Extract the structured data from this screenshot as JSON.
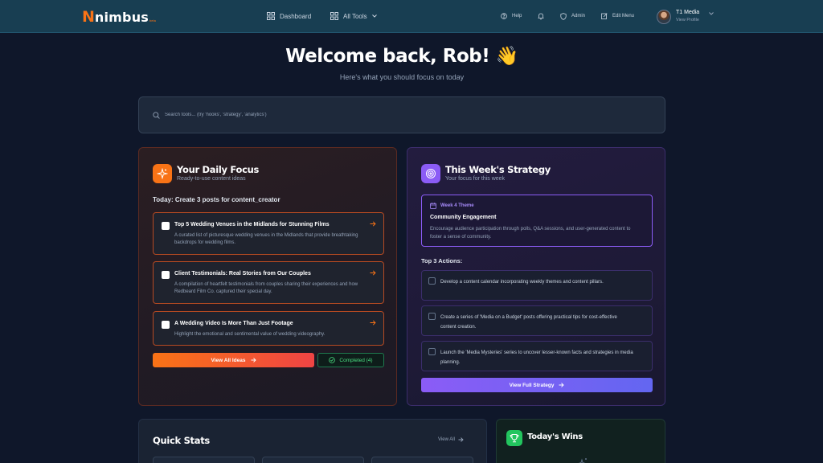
{
  "nav": {
    "logo_text": "nimbus",
    "logo_tag": "beta",
    "dashboard": "Dashboard",
    "all_tools": "All Tools",
    "help": "Help",
    "admin": "Admin",
    "edit_menu": "Edit Menu",
    "profile_name": "T1 Media",
    "profile_sub": "View Profile"
  },
  "hero": {
    "title": "Welcome back, Rob! 👋",
    "subtitle": "Here's what you should focus on today"
  },
  "search": {
    "placeholder": "Search tools... (try 'hooks', 'strategy', 'analytics')"
  },
  "daily_focus": {
    "title": "Your Daily Focus",
    "subtitle": "Ready-to-use content ideas",
    "heading": "Today: Create 3 posts for content_creator",
    "ideas": [
      {
        "title": "Top 5 Wedding Venues in the Midlands for Stunning Films",
        "desc": "A curated list of picturesque wedding venues in the Midlands that provide breathtaking backdrops for wedding films."
      },
      {
        "title": "Client Testimonials: Real Stories from Our Couples",
        "desc": "A compilation of heartfelt testimonials from couples sharing their experiences and how Redbeard Film Co. captured their special day."
      },
      {
        "title": "A Wedding Video Is More Than Just Footage",
        "desc": "Highlight the emotional and sentimental value of wedding videography."
      }
    ],
    "view_all_label": "View All Ideas",
    "completed_label": "Completed (4)"
  },
  "strategy": {
    "title": "This Week's Strategy",
    "subtitle": "Your focus for this week",
    "theme_label": "Week 4 Theme",
    "theme_title": "Community Engagement",
    "theme_desc": "Encourage audience participation through polls, Q&A sessions, and user-generated content to foster a sense of community.",
    "actions_heading": "Top 3 Actions:",
    "actions": [
      "Develop a content calendar incorporating weekly themes and content pillars.",
      "Create a series of 'Media on a Budget' posts offering practical tips for cost-effective content creation.",
      "Launch the 'Media Mysteries' series to uncover lesser-known facts and strategies in media planning."
    ],
    "button_label": "View Full Strategy"
  },
  "quick_stats": {
    "title": "Quick Stats",
    "view_all": "View All"
  },
  "wins": {
    "title": "Today's Wins"
  },
  "colors": {
    "accent_orange": "#f97316",
    "accent_purple": "#8b5cf6",
    "accent_green": "#22c55e",
    "nav_bg": "#183e52",
    "page_bg": "#0f172a"
  },
  "icons": {
    "dashboard": "grid-icon",
    "all_tools": "grid-icon",
    "help": "help-circle-icon",
    "notifications": "bell-icon",
    "admin": "shield-icon",
    "edit_menu": "edit-icon",
    "focus": "sparkles-icon",
    "strategy": "target-icon",
    "wins": "trophy-icon"
  }
}
